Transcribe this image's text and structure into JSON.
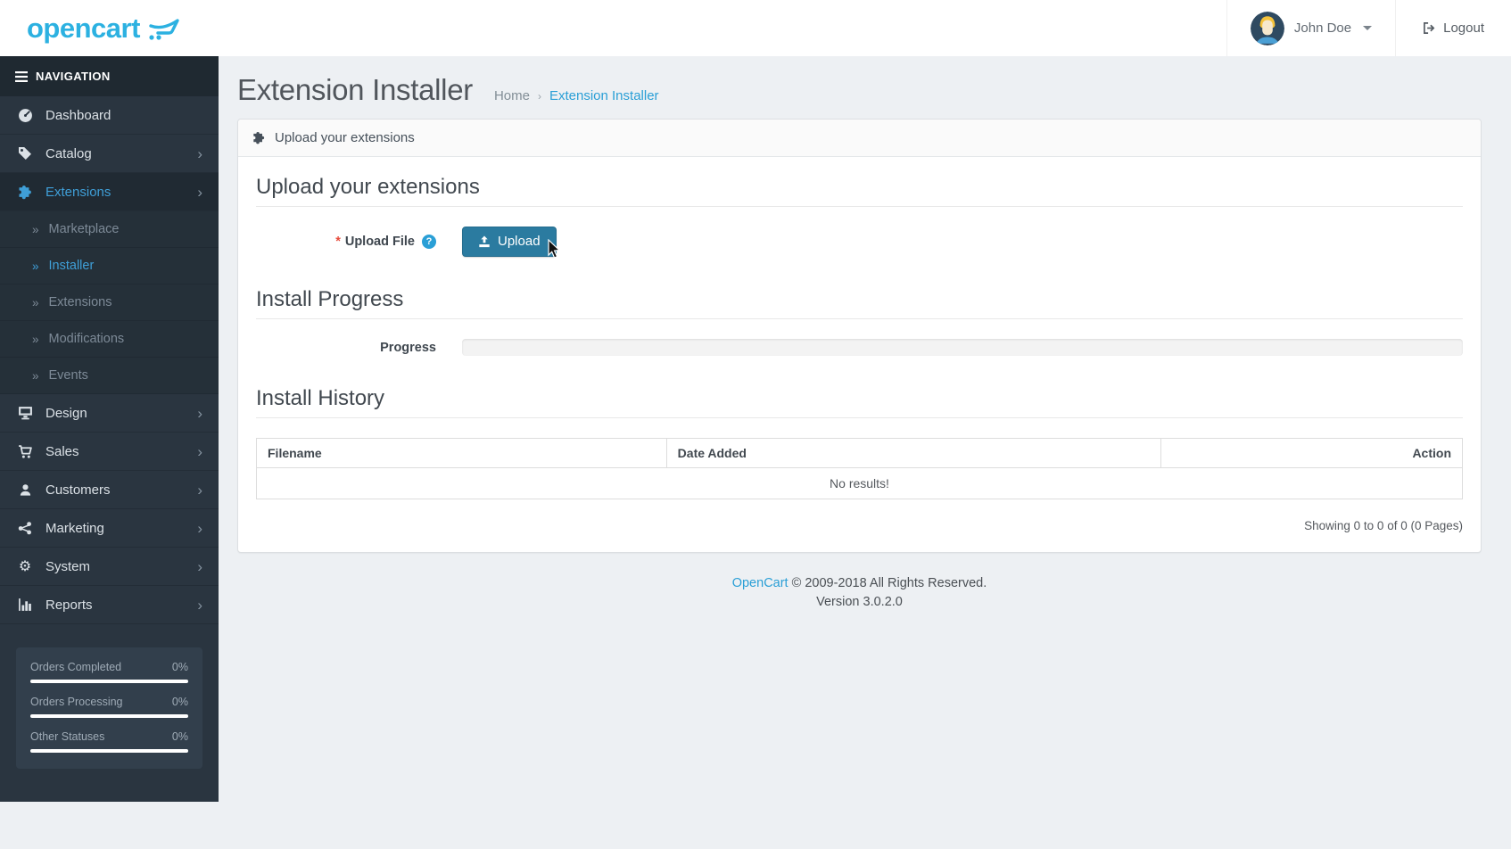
{
  "header": {
    "logo_text": "opencart",
    "user_name": "John Doe",
    "logout_label": "Logout"
  },
  "sidebar": {
    "nav_header": "NAVIGATION",
    "items": [
      {
        "label": "Dashboard"
      },
      {
        "label": "Catalog"
      },
      {
        "label": "Extensions"
      },
      {
        "label": "Marketplace"
      },
      {
        "label": "Installer"
      },
      {
        "label": "Extensions"
      },
      {
        "label": "Modifications"
      },
      {
        "label": "Events"
      },
      {
        "label": "Design"
      },
      {
        "label": "Sales"
      },
      {
        "label": "Customers"
      },
      {
        "label": "Marketing"
      },
      {
        "label": "System"
      },
      {
        "label": "Reports"
      }
    ],
    "stats": [
      {
        "label": "Orders Completed",
        "value": "0%"
      },
      {
        "label": "Orders Processing",
        "value": "0%"
      },
      {
        "label": "Other Statuses",
        "value": "0%"
      }
    ]
  },
  "page": {
    "title": "Extension Installer",
    "breadcrumb": [
      {
        "label": "Home"
      },
      {
        "label": "Extension Installer"
      }
    ]
  },
  "panel": {
    "heading": "Upload your extensions",
    "sections": {
      "upload_title": "Upload your extensions",
      "progress_title": "Install Progress",
      "history_title": "Install History"
    },
    "form": {
      "required_mark": "*",
      "upload_label": "Upload File",
      "upload_button_label": "Upload",
      "progress_label": "Progress"
    },
    "table": {
      "columns": [
        {
          "label": "Filename"
        },
        {
          "label": "Date Added"
        },
        {
          "label": "Action"
        }
      ],
      "empty_text": "No results!"
    },
    "results_summary": "Showing 0 to 0 of 0 (0 Pages)"
  },
  "footer": {
    "link_label": "OpenCart",
    "copyright": "© 2009-2018 All Rights Reserved.",
    "version": "Version 3.0.2.0"
  },
  "colors": {
    "accent_blue": "#2a9fd6",
    "logo_blue": "#2cb1e1",
    "upload_button_blue": "#2b7ba0",
    "sidebar_bg": "#2a3540",
    "required_red": "#e74c3c"
  }
}
